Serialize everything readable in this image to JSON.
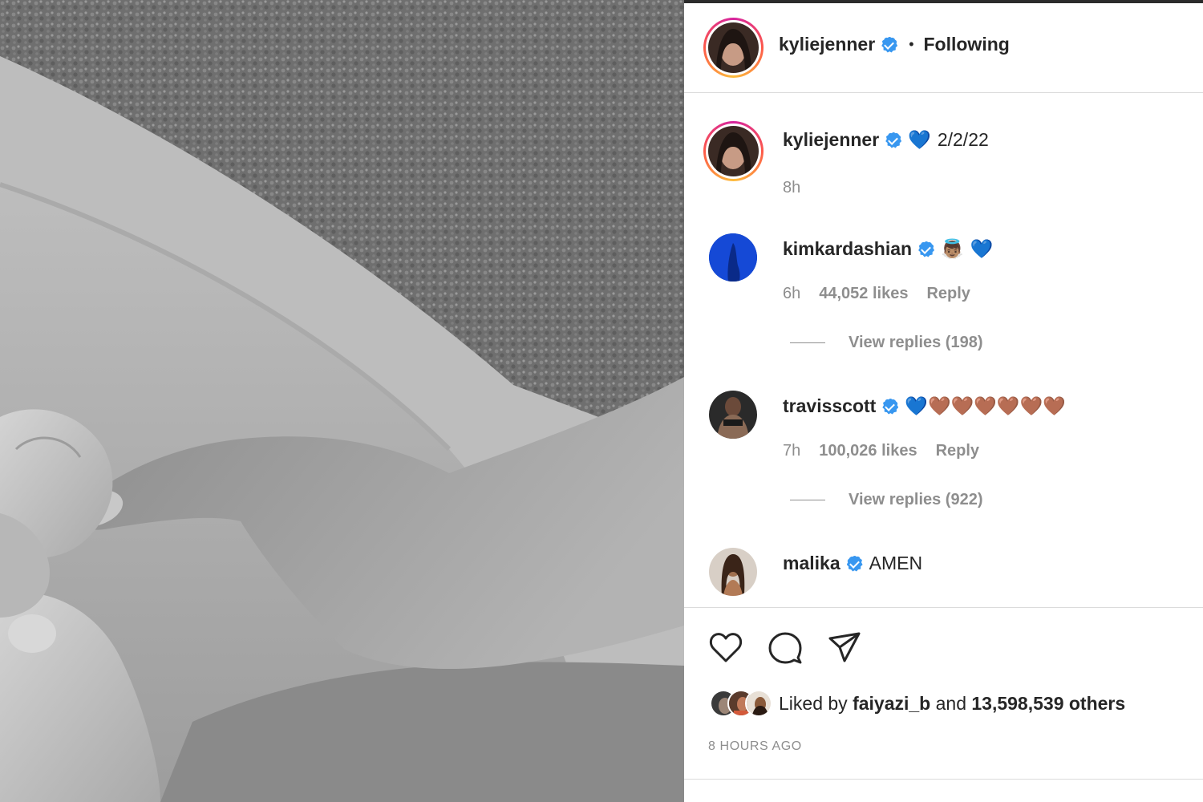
{
  "post": {
    "author": "kyliejenner",
    "separator": "•",
    "follow_status": "Following",
    "caption_emoji": "💙",
    "caption_text": "2/2/22",
    "caption_time": "8h"
  },
  "comments": [
    {
      "username": "kimkardashian",
      "emoji": "👼🏽",
      "heart_emoji": "💙",
      "time": "6h",
      "likes": "44,052 likes",
      "reply_label": "Reply",
      "view_replies": "View replies (198)"
    },
    {
      "username": "travisscott",
      "emoji": "💙🤎🤎🤎🤎🤎🤎",
      "time": "7h",
      "likes": "100,026 likes",
      "reply_label": "Reply",
      "view_replies": "View replies (922)"
    },
    {
      "username": "malika",
      "text": "AMEN"
    }
  ],
  "actions": {
    "like_icon": "heart-outline-icon",
    "comment_icon": "comment-bubble-icon",
    "share_icon": "paper-plane-icon"
  },
  "likes_summary": {
    "prefix": "Liked by",
    "user": "faiyazi_b",
    "middle": "and",
    "count": "13,598,539 others"
  },
  "timestamp": "8 HOURS AGO",
  "colors": {
    "verified": "#3897f0",
    "heart_blue": "#1e7bd8",
    "heart_brown": "#8b5a2b",
    "meta_gray": "#8e8e8e",
    "divider": "#dbdbdb"
  }
}
